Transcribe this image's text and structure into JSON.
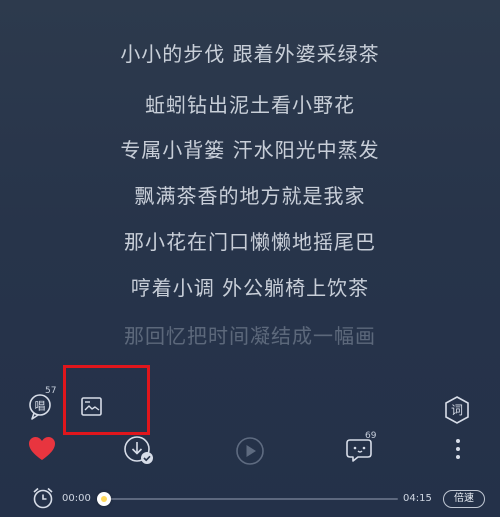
{
  "lyrics": [
    "小小的步伐 跟着外婆采绿茶",
    "蚯蚓钻出泥土看小野花",
    "专属小背篓 汗水阳光中蒸发",
    "飘满茶香的地方就是我家",
    "那小花在门口懒懒地摇尾巴",
    "哼着小调 外公躺椅上饮茶",
    "那回忆把时间凝结成一幅画"
  ],
  "top_row": {
    "sing_badge": "57",
    "sing_label": "唱",
    "lyrics_button_label": "词"
  },
  "actions": {
    "comment_count": "69"
  },
  "player": {
    "current_time": "00:00",
    "total_time": "04:15",
    "speed_label": "倍速",
    "progress": 0.02
  },
  "colors": {
    "like": "#e8353f",
    "highlight": "#e0161c"
  }
}
